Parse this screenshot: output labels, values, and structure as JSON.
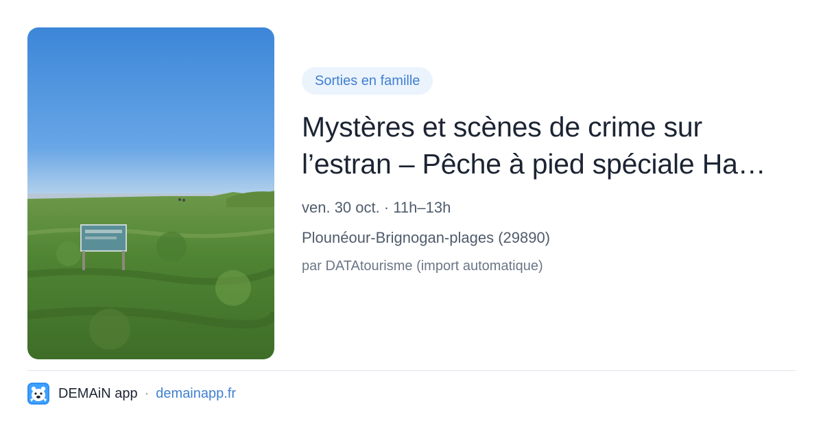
{
  "event": {
    "category": "Sorties en famille",
    "title": "Mystères et scènes de crime sur l’estran – Pêche à pied spéciale Ha…",
    "datetime": "ven. 30 oct. · 11h–13h",
    "location": "Plounéour-Brignogan-plages (29890)",
    "source": "par DATAtourisme (import automatique)",
    "image_icon": "landscape-photo"
  },
  "footer": {
    "app_name": "DEMAiN app",
    "separator": "·",
    "domain": "demainapp.fr",
    "logo_icon": "demain-logo-icon"
  },
  "colors": {
    "accent": "#3f7fd0",
    "badge_bg": "#ebf3fd",
    "title": "#1c2433",
    "meta": "#4f5b6b"
  }
}
